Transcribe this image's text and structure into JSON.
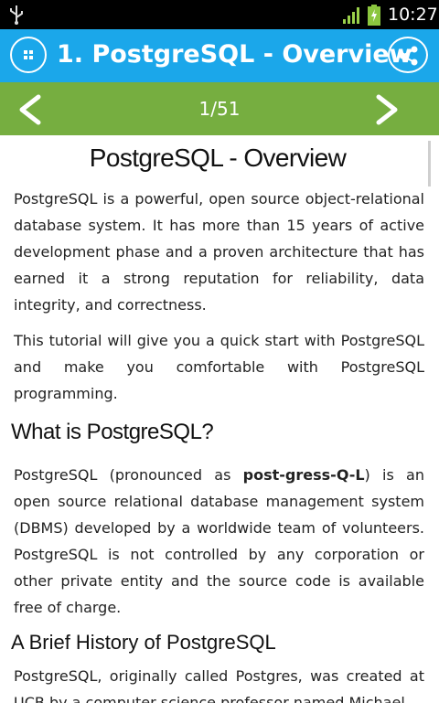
{
  "status_bar": {
    "time": "10:27",
    "icons": [
      "usb-icon",
      "signal-icon",
      "battery-charging-icon"
    ]
  },
  "app_bar": {
    "title": "1. PostgreSQL - Overview",
    "menu_icon": "grid-menu-icon",
    "share_icon": "share-icon"
  },
  "nav": {
    "prev_glyph": "<",
    "next_glyph": ">",
    "page_indicator": "1/51"
  },
  "article": {
    "title": "PostgreSQL - Overview",
    "p1": "PostgreSQL is a powerful, open source object-relational database system. It has more than 15 years of active development phase and a proven architecture that has earned it a strong reputation for reliability, data integrity, and correctness.",
    "p2": "This tutorial will give you a quick start with PostgreSQL and make you comfortable with PostgreSQL programming.",
    "h_what": "What is PostgreSQL?",
    "p3_before": "PostgreSQL (pronounced as ",
    "p3_bold": "post-gress-Q-L",
    "p3_after": ") is an open source relational database management system (DBMS) developed by a worldwide team of volunteers. PostgreSQL is not controlled by any corporation or other private entity and the source code is available free of charge.",
    "h_history": "A Brief History of PostgreSQL",
    "p4": "PostgreSQL, originally called Postgres, was created at UCB by a computer science professor named Michael"
  },
  "colors": {
    "app_bar": "#1ba7ea",
    "nav_bar": "#76ae40",
    "status_bar": "#000000"
  }
}
